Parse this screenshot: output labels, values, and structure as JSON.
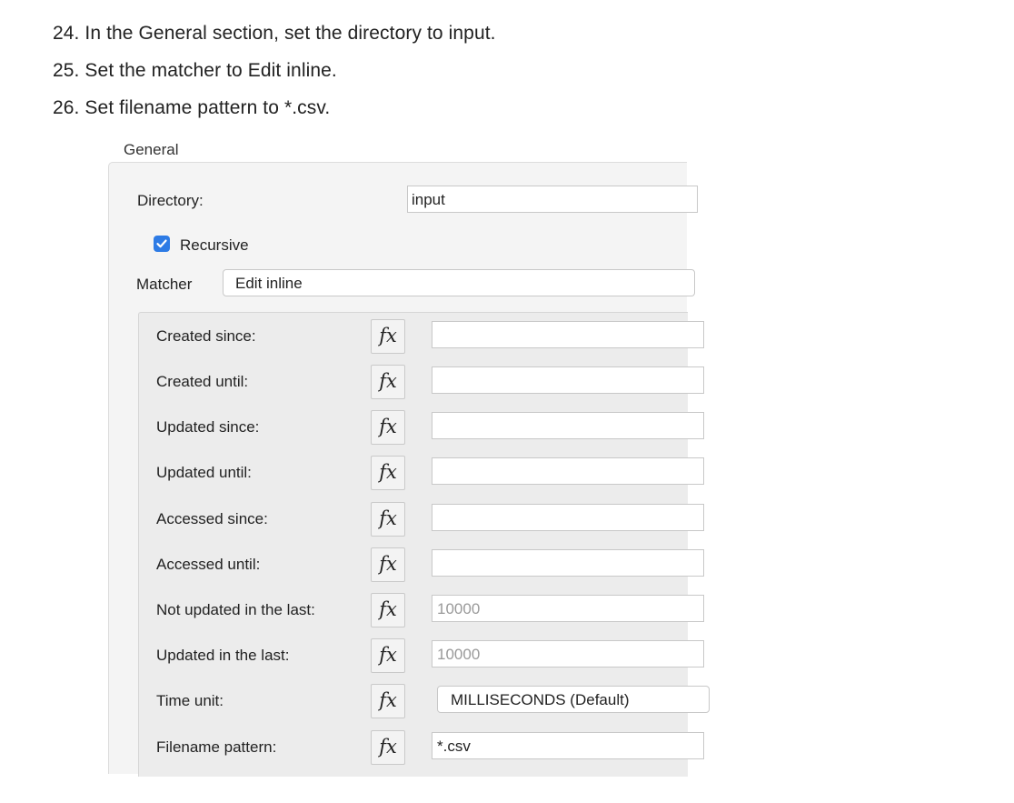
{
  "instructions": [
    "24. In the General section, set the directory to input.",
    "25. Set the matcher to Edit inline.",
    "26. Set filename pattern to *.csv."
  ],
  "general": {
    "title": "General",
    "directory_label": "Directory:",
    "directory_value": "input",
    "recursive_label": "Recursive",
    "recursive_checked": true,
    "matcher_label": "Matcher",
    "matcher_value": "Edit inline"
  },
  "matcher_fields": [
    {
      "label": "Created since:",
      "value": "",
      "fx": "fx"
    },
    {
      "label": "Created until:",
      "value": "",
      "fx": "fx"
    },
    {
      "label": "Updated since:",
      "value": "",
      "fx": "fx"
    },
    {
      "label": "Updated until:",
      "value": "",
      "fx": "fx"
    },
    {
      "label": "Accessed since:",
      "value": "",
      "fx": "fx"
    },
    {
      "label": "Accessed until:",
      "value": "",
      "fx": "fx"
    },
    {
      "label": "Not updated in the last:",
      "value": "10000",
      "fx": "fx"
    },
    {
      "label": "Updated in the last:",
      "value": "10000",
      "fx": "fx"
    },
    {
      "label": "Time unit:",
      "value": "MILLISECONDS (Default)",
      "fx": "fx"
    },
    {
      "label": "Filename pattern:",
      "value": "*.csv",
      "fx": "fx"
    }
  ],
  "colors": {
    "checkbox": "#2d7be5",
    "placeholder_text": "#9a9a9a"
  },
  "icons": {
    "checkbox": "checkmark-icon",
    "expression": "fx-function-icon"
  }
}
